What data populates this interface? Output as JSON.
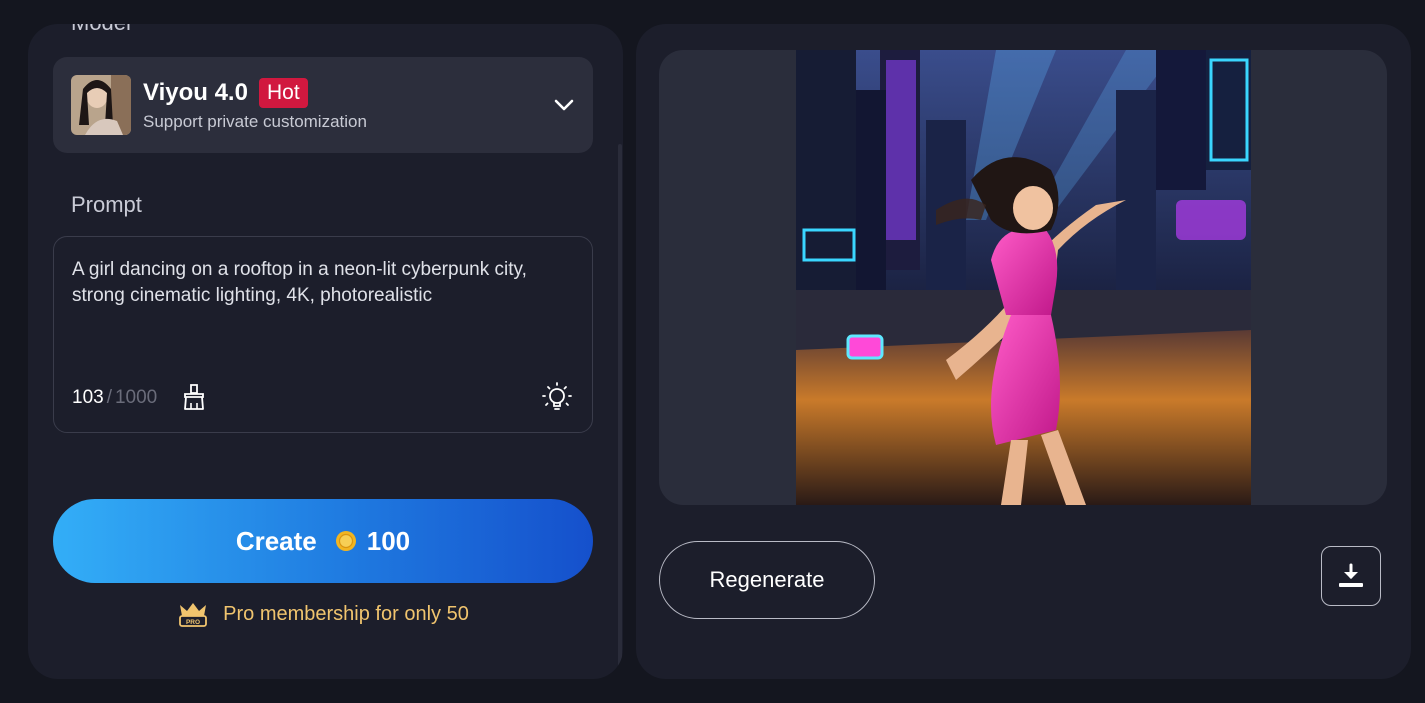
{
  "model": {
    "section_label": "Model",
    "name": "Viyou 4.0",
    "badge": "Hot",
    "description": "Support private customization",
    "avatar_icon": "model-avatar-portrait",
    "chevron_icon": "chevron-down-icon"
  },
  "prompt": {
    "section_label": "Prompt",
    "text": "A girl dancing on a rooftop in a neon-lit cyberpunk city, strong cinematic lighting, 4K, photorealistic",
    "char_count": "103",
    "char_separator": "/",
    "char_max": "1000",
    "clear_icon": "brush-icon",
    "inspire_icon": "lightbulb-icon"
  },
  "create": {
    "label": "Create",
    "coin_icon": "coin-icon",
    "cost": "100"
  },
  "pro": {
    "icon": "pro-crown-icon",
    "text": "Pro membership for only 50"
  },
  "result": {
    "image_description_icon": "generated-image",
    "regenerate_label": "Regenerate",
    "download_icon": "download-icon"
  },
  "colors": {
    "background": "#14161f",
    "panel": "#1c1e2b",
    "badge": "#d1183f",
    "accent_gradient_start": "#33aef7",
    "accent_gradient_end": "#1550cc",
    "pro_text": "#f0c46e"
  }
}
